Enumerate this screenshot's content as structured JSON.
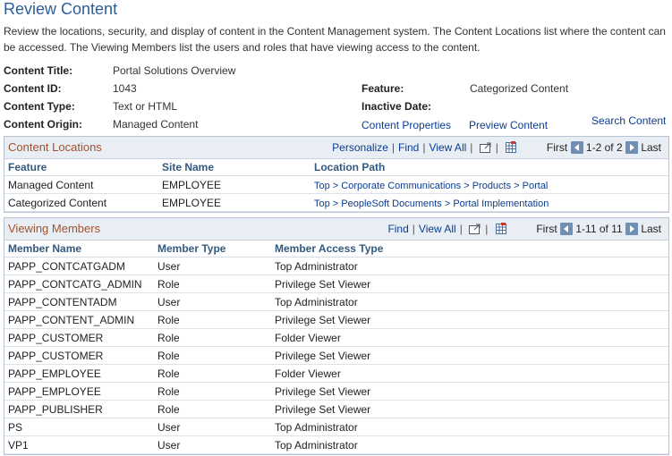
{
  "page": {
    "title": "Review Content",
    "description": "Review the locations, security, and display of content in the Content Management system.  The Content Locations list where the content can be accessed. The Viewing Members list the users and roles that have viewing access to the content."
  },
  "fields": {
    "content_title_label": "Content Title:",
    "content_title_value": "Portal Solutions Overview",
    "content_id_label": "Content ID:",
    "content_id_value": "1043",
    "content_type_label": "Content Type:",
    "content_type_value": "Text or HTML",
    "content_origin_label": "Content Origin:",
    "content_origin_value": "Managed Content",
    "feature_label": "Feature:",
    "feature_value": "Categorized Content",
    "inactive_date_label": "Inactive Date:",
    "inactive_date_value": ""
  },
  "links": {
    "content_properties": "Content Properties",
    "preview_content": "Preview Content",
    "search_content": "Search Content"
  },
  "locations": {
    "title": "Content Locations",
    "personalize": "Personalize",
    "find": "Find",
    "view_all": "View All",
    "first": "First",
    "range": "1-2 of 2",
    "last": "Last",
    "columns": [
      "Feature",
      "Site Name",
      "Location Path"
    ],
    "rows": [
      {
        "feature": "Managed Content",
        "site": "EMPLOYEE",
        "path": "Top > Corporate Communications > Products > Portal"
      },
      {
        "feature": "Categorized Content",
        "site": "EMPLOYEE",
        "path": "Top > PeopleSoft Documents > Portal Implementation"
      }
    ]
  },
  "members": {
    "title": "Viewing Members",
    "find": "Find",
    "view_all": "View All",
    "first": "First",
    "range": "1-11 of 11",
    "last": "Last",
    "columns": [
      "Member Name",
      "Member Type",
      "Member Access Type"
    ],
    "rows": [
      {
        "name": "PAPP_CONTCATGADM",
        "type": "User",
        "access": "Top Administrator"
      },
      {
        "name": "PAPP_CONTCATG_ADMIN",
        "type": "Role",
        "access": "Privilege Set Viewer"
      },
      {
        "name": "PAPP_CONTENTADM",
        "type": "User",
        "access": "Top Administrator"
      },
      {
        "name": "PAPP_CONTENT_ADMIN",
        "type": "Role",
        "access": "Privilege Set Viewer"
      },
      {
        "name": "PAPP_CUSTOMER",
        "type": "Role",
        "access": "Folder Viewer"
      },
      {
        "name": "PAPP_CUSTOMER",
        "type": "Role",
        "access": "Privilege Set Viewer"
      },
      {
        "name": "PAPP_EMPLOYEE",
        "type": "Role",
        "access": "Folder Viewer"
      },
      {
        "name": "PAPP_EMPLOYEE",
        "type": "Role",
        "access": "Privilege Set Viewer"
      },
      {
        "name": "PAPP_PUBLISHER",
        "type": "Role",
        "access": "Privilege Set Viewer"
      },
      {
        "name": "PS",
        "type": "User",
        "access": "Top Administrator"
      },
      {
        "name": "VP1",
        "type": "User",
        "access": "Top Administrator"
      }
    ]
  },
  "icons": {
    "zoom": "zoom-window-icon",
    "download": "download-to-excel-icon",
    "prev": "previous-icon",
    "next": "next-icon"
  },
  "colors": {
    "title_blue": "#2c5d9a",
    "grid_title_brown": "#a0522d",
    "header_blue": "#34597f",
    "link_blue": "#0a3d91",
    "grid_header_bg": "#e9eef4"
  }
}
